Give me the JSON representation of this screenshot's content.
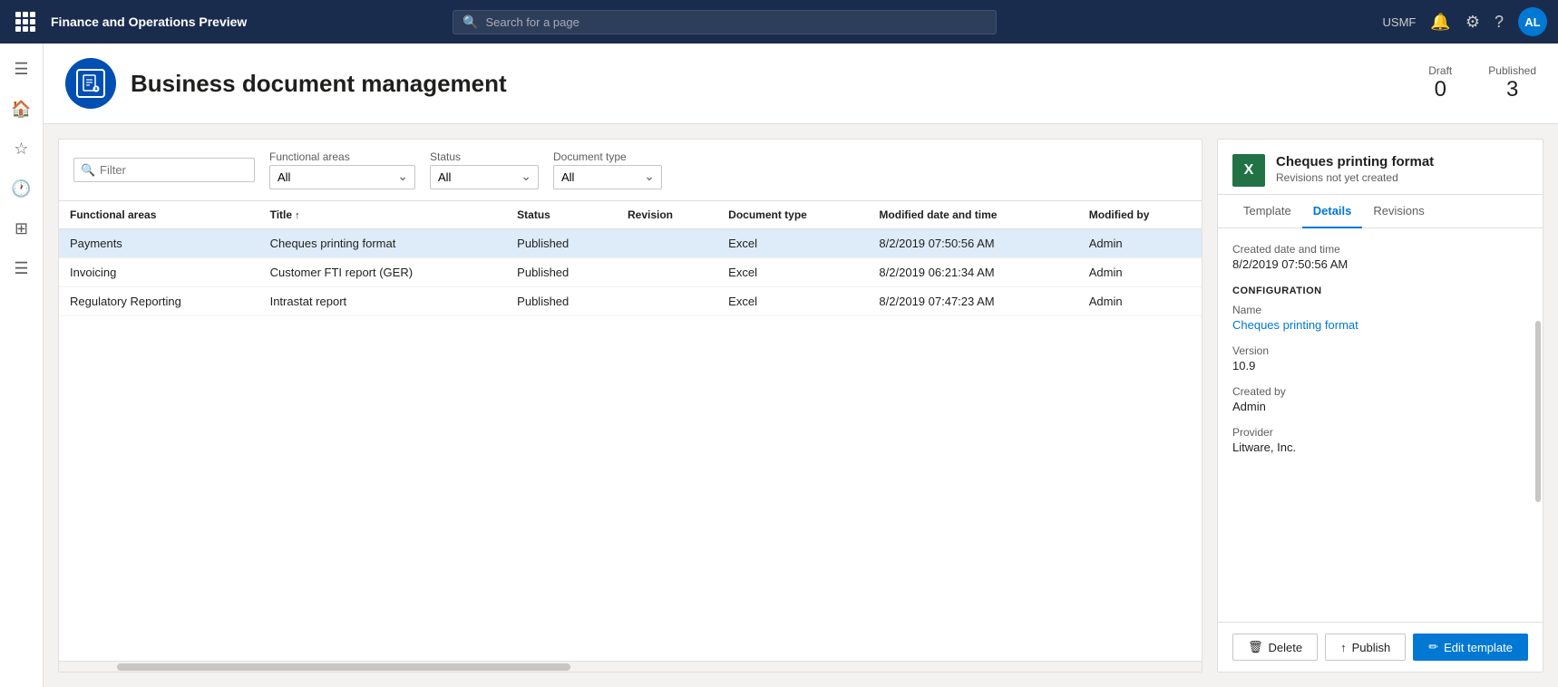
{
  "topbar": {
    "title": "Finance and Operations Preview",
    "search_placeholder": "Search for a page",
    "env": "USMF"
  },
  "topbar_avatar": "AL",
  "page": {
    "title": "Business document management",
    "icon_letter": "≡",
    "stats": {
      "draft_label": "Draft",
      "draft_value": "0",
      "published_label": "Published",
      "published_value": "3"
    }
  },
  "filters": {
    "filter_placeholder": "Filter",
    "functional_areas_label": "Functional areas",
    "functional_areas_value": "All",
    "status_label": "Status",
    "status_value": "All",
    "document_type_label": "Document type",
    "document_type_value": "All"
  },
  "table": {
    "columns": [
      "Functional areas",
      "Title",
      "Status",
      "Revision",
      "Document type",
      "Modified date and time",
      "Modified by"
    ],
    "rows": [
      {
        "functional_areas": "Payments",
        "title": "Cheques printing format",
        "status": "Published",
        "revision": "",
        "document_type": "Excel",
        "modified": "8/2/2019 07:50:56 AM",
        "modified_by": "Admin",
        "selected": true
      },
      {
        "functional_areas": "Invoicing",
        "title": "Customer FTI report (GER)",
        "status": "Published",
        "revision": "",
        "document_type": "Excel",
        "modified": "8/2/2019 06:21:34 AM",
        "modified_by": "Admin",
        "selected": false
      },
      {
        "functional_areas": "Regulatory Reporting",
        "title": "Intrastat report",
        "status": "Published",
        "revision": "",
        "document_type": "Excel",
        "modified": "8/2/2019 07:47:23 AM",
        "modified_by": "Admin",
        "selected": false
      }
    ]
  },
  "detail": {
    "icon_letter": "X",
    "title": "Cheques printing format",
    "subtitle": "Revisions not yet created",
    "tabs": [
      {
        "label": "Template",
        "active": false
      },
      {
        "label": "Details",
        "active": true
      },
      {
        "label": "Revisions",
        "active": false
      }
    ],
    "created_label": "Created date and time",
    "created_value": "8/2/2019 07:50:56 AM",
    "section_config": "CONFIGURATION",
    "name_label": "Name",
    "name_value": "Cheques printing format",
    "version_label": "Version",
    "version_value": "10.9",
    "created_by_label": "Created by",
    "created_by_value": "Admin",
    "provider_label": "Provider",
    "provider_value": "Litware, Inc."
  },
  "buttons": {
    "delete": "Delete",
    "publish": "Publish",
    "edit_template": "Edit template"
  }
}
